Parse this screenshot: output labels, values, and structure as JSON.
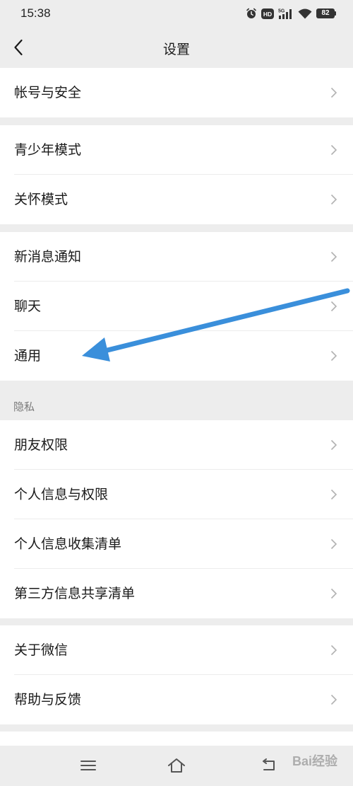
{
  "status_bar": {
    "time": "15:38",
    "network": "5G",
    "hd_badge": "HD",
    "battery": "82",
    "icons": [
      "alarm-icon",
      "hd-icon",
      "signal-5g-icon",
      "wifi-icon",
      "battery-icon"
    ]
  },
  "header": {
    "title": "设置",
    "back_icon": "chevron-left-icon"
  },
  "groups": [
    {
      "items": [
        {
          "label": "帐号与安全"
        }
      ]
    },
    {
      "items": [
        {
          "label": "青少年模式"
        },
        {
          "label": "关怀模式"
        }
      ]
    },
    {
      "items": [
        {
          "label": "新消息通知"
        },
        {
          "label": "聊天"
        },
        {
          "label": "通用"
        }
      ]
    },
    {
      "header": "隐私",
      "items": [
        {
          "label": "朋友权限"
        },
        {
          "label": "个人信息与权限"
        },
        {
          "label": "个人信息收集清单"
        },
        {
          "label": "第三方信息共享清单"
        }
      ]
    },
    {
      "items": [
        {
          "label": "关于微信"
        },
        {
          "label": "帮助与反馈"
        }
      ]
    }
  ],
  "system_nav": {
    "icons": [
      "menu-icon",
      "home-icon",
      "back-nav-icon"
    ]
  },
  "annotation": {
    "arrow_color": "#3a8fdb",
    "arrow_target": "通用"
  },
  "watermark": {
    "text": "Bai经验"
  },
  "colors": {
    "background": "#ededed",
    "surface": "#ffffff",
    "text": "#1a1a1a",
    "secondary_text": "#7a7a7a",
    "chevron": "#b2b2b2"
  }
}
